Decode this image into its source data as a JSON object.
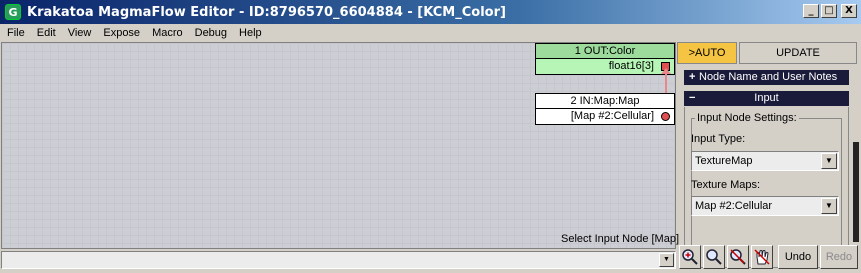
{
  "window": {
    "title": "Krakatoa MagmaFlow Editor - ID:8796570_6604884 - [KCM_Color]",
    "app_icon": "G"
  },
  "window_controls": {
    "minimize": "_",
    "maximize": "□",
    "close": "X"
  },
  "menu": [
    "File",
    "Edit",
    "View",
    "Expose",
    "Macro",
    "Debug",
    "Help"
  ],
  "nodes": {
    "out": {
      "title": "1 OUT:Color",
      "socket_label": "float16[3]"
    },
    "in": {
      "title": "2 IN:Map:Map",
      "socket_label": "[Map #2:Cellular]"
    }
  },
  "status": {
    "text": "Select Input Node [Map]",
    "dropdown": "▼"
  },
  "panel": {
    "auto_label": ">AUTO",
    "update_label": "UPDATE",
    "rollout_node_name": {
      "symbol": "+",
      "label": "Node Name and User Notes"
    },
    "rollout_input": {
      "symbol": "−",
      "label": "Input"
    },
    "group_title": "Input Node Settings:",
    "input_type_label": "Input Type:",
    "input_type_value": "TextureMap",
    "texture_maps_label": "Texture Maps:",
    "texture_maps_value": "Map #2:Cellular",
    "combo_arrow": "▼"
  },
  "toolbar": {
    "undo_label": "Undo",
    "redo_label": "Redo"
  },
  "colors": {
    "accent_auto": "#f5c443",
    "out_node_header": "#9ddb9d",
    "out_node_row": "#b6f5b6",
    "socket": "#e05050",
    "wire": "#e8888a"
  }
}
